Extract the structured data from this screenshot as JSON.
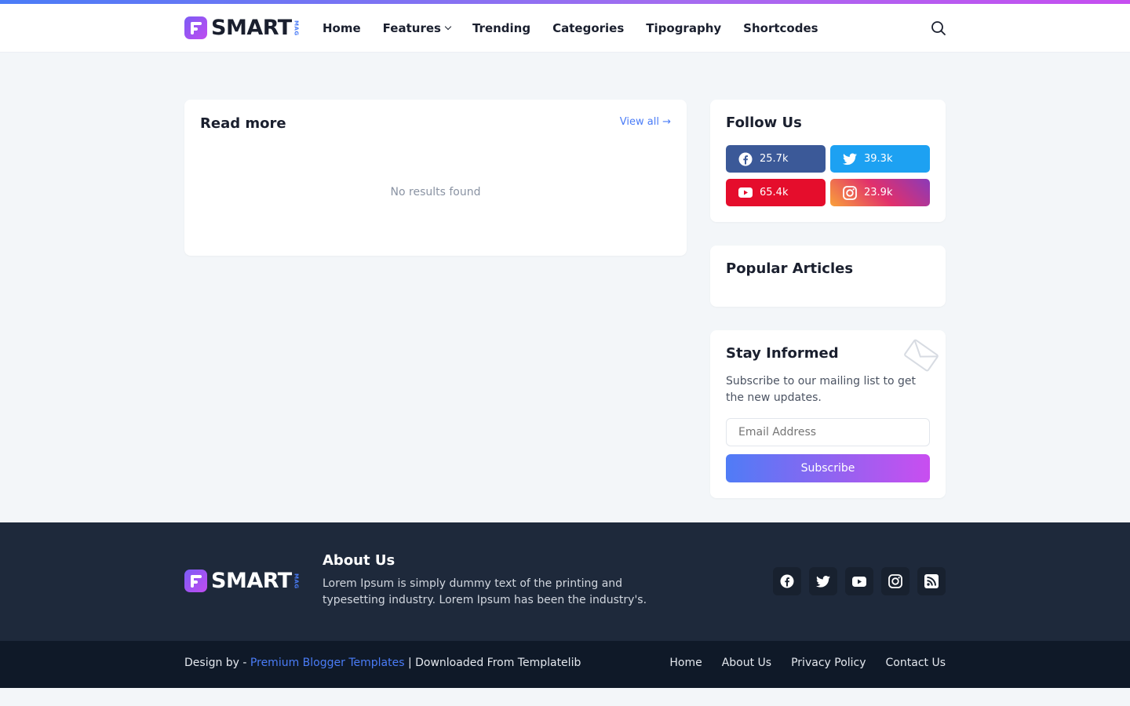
{
  "header": {
    "logo": {
      "word": "SMART",
      "sub": "MAG"
    },
    "nav": [
      {
        "label": "Home"
      },
      {
        "label": "Features"
      },
      {
        "label": "Trending"
      },
      {
        "label": "Categories"
      },
      {
        "label": "Tipography"
      },
      {
        "label": "Shortcodes"
      }
    ],
    "icons": {
      "search": "search-icon",
      "dropdown": "chevron-down-icon"
    }
  },
  "main": {
    "readmore": {
      "title": "Read more",
      "view_all": "View all",
      "empty": "No results found"
    }
  },
  "sidebar": {
    "follow": {
      "title": "Follow Us",
      "items": [
        {
          "network": "facebook",
          "count": "25.7k",
          "color": "#3b5998",
          "icon": "facebook-icon"
        },
        {
          "network": "twitter",
          "count": "39.3k",
          "color": "#1da1f2",
          "icon": "twitter-icon"
        },
        {
          "network": "youtube",
          "count": "65.4k",
          "color": "#e50d2c",
          "icon": "youtube-icon"
        },
        {
          "network": "instagram",
          "count": "23.9k",
          "color": "#e1306c",
          "icon": "instagram-icon"
        }
      ]
    },
    "popular": {
      "title": "Popular Articles"
    },
    "newsletter": {
      "title": "Stay Informed",
      "text": "Subscribe to our mailing list to get the new updates.",
      "placeholder": "Email Address",
      "button": "Subscribe"
    }
  },
  "footer": {
    "logo": {
      "word": "SMART",
      "sub": "MAG"
    },
    "about_title": "About Us",
    "about_text": "Lorem Ipsum is simply dummy text of the printing and typesetting industry. Lorem Ipsum has been the industry's.",
    "social_icons": [
      "facebook-icon",
      "twitter-icon",
      "youtube-icon",
      "instagram-icon",
      "rss-icon"
    ],
    "credit_prefix": "Design by - ",
    "credit_link": "Premium Blogger Templates",
    "credit_suffix": " | Downloaded From Templatelib",
    "links": [
      {
        "label": "Home"
      },
      {
        "label": "About Us"
      },
      {
        "label": "Privacy Policy"
      },
      {
        "label": "Contact Us"
      }
    ]
  },
  "colors": {
    "accent": "#4a7cf7",
    "gradient_start": "#4f7cf6",
    "gradient_end": "#c94ef0",
    "footer_bg": "#1e293b",
    "bottom_bg": "#0f1928",
    "page_bg": "#f3f6f9"
  }
}
